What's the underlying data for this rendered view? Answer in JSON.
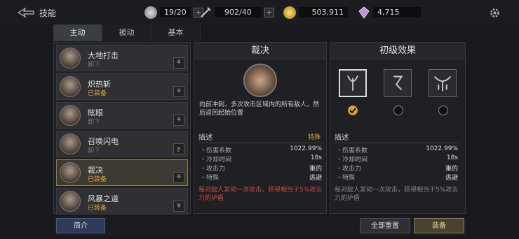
{
  "header": {
    "title": "技能",
    "coins": [
      {
        "value": "19/20",
        "icon": "silver-badge-icon"
      },
      {
        "value": "902/40",
        "icon": "sword-icon"
      },
      {
        "value": "503,911",
        "icon": "gold-coin-icon"
      },
      {
        "value": "4,715",
        "icon": "purple-crystal-icon"
      }
    ]
  },
  "tabs": [
    {
      "label": "主动"
    },
    {
      "label": "被动"
    },
    {
      "label": "基本"
    }
  ],
  "skills": [
    {
      "name": "大地打击",
      "status": "卸下"
    },
    {
      "name": "炽热斩",
      "status": "已装备"
    },
    {
      "name": "眩眼",
      "status": "卸下"
    },
    {
      "name": "召唤闪电",
      "status": "卸下"
    },
    {
      "name": "裁决",
      "status": "已装备"
    },
    {
      "name": "风暴之道",
      "status": "已装备"
    }
  ],
  "detail": {
    "title": "裁决",
    "desc": "向前冲刺，多次攻击区域内的所有敌人，然后返回起始位置",
    "section": "描述",
    "tag": "特殊",
    "stats": [
      {
        "k": "・伤害系数",
        "v": "1022.99%"
      },
      {
        "k": "・冷却时间",
        "v": "18s"
      },
      {
        "k": "・攻击力",
        "v": "重的"
      },
      {
        "k": "・特殊",
        "v": "逃避"
      }
    ],
    "note": "每对敌人发动一次攻击，获得相当于5%攻击力的护盾"
  },
  "effects": {
    "title": "初级效果",
    "section": "描述",
    "stats": [
      {
        "k": "・伤害系数",
        "v": "1022.99%"
      },
      {
        "k": "・冷却时间",
        "v": "18s"
      },
      {
        "k": "・攻击力",
        "v": "重的"
      },
      {
        "k": "・特殊",
        "v": "逃避"
      }
    ],
    "note": "每对敌人发动一次攻击，获得相当于5%攻击力的护盾"
  },
  "buttons": {
    "intro": "简介",
    "reset": "全部重置",
    "equip": "装备"
  }
}
